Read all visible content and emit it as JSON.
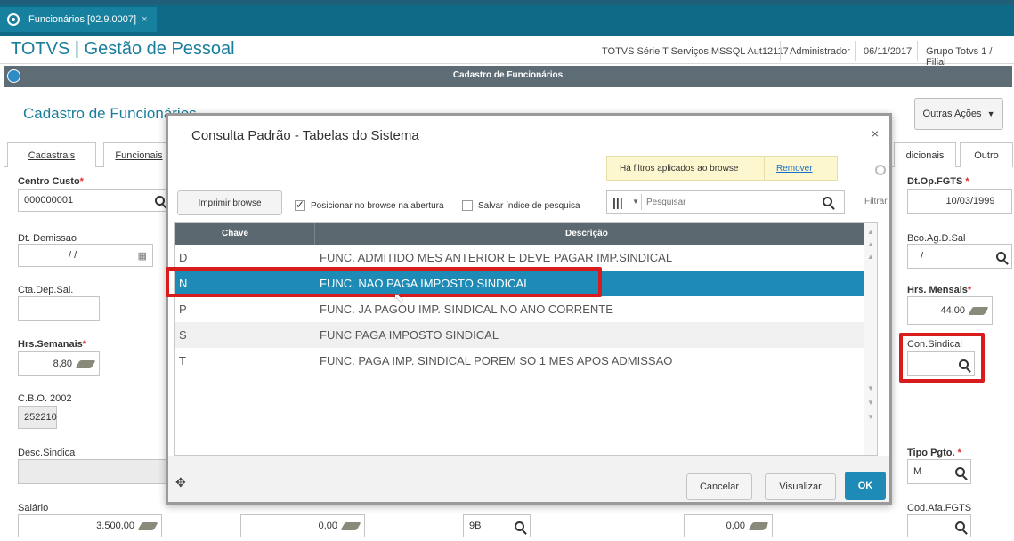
{
  "tab": {
    "label": "Funcionários [02.9.0007]",
    "close": "×"
  },
  "header": {
    "title": "TOTVS | Gestão de Pessoal",
    "server": "TOTVS Série T Serviços MSSQL Aut12117",
    "user": "Administrador",
    "date": "06/11/2017",
    "group": "Grupo Totvs 1 / Filial"
  },
  "formbar": {
    "title": "Cadastro de Funcionários"
  },
  "form": {
    "title": "Cadastro de Funcionários",
    "outras_acoes": "Outras Ações",
    "tabs": [
      "Cadastrais",
      "Funcionais",
      "dicionais",
      "Outro"
    ],
    "centro_custo": {
      "label": "Centro Custo",
      "value": "000000001"
    },
    "dt_demissao": {
      "label": "Dt. Demissao",
      "value": "/ /"
    },
    "cta_dep_sal": {
      "label": "Cta.Dep.Sal."
    },
    "hrs_semanais": {
      "label": "Hrs.Semanais",
      "value": "8,80"
    },
    "cbo": {
      "label": "C.B.O. 2002",
      "value": "252210"
    },
    "desc_sindica": {
      "label": "Desc.Sindica"
    },
    "salario": {
      "label": "Salário",
      "value": "3.500,00"
    },
    "dt_op_fgts": {
      "label": "Dt.Op.FGTS",
      "value": "10/03/1999"
    },
    "bco_ag": {
      "label": "Bco.Ag.D.Sal",
      "value": "/"
    },
    "hrs_mensais": {
      "label": "Hrs. Mensais",
      "value": "44,00"
    },
    "con_sindical": {
      "label": "Con.Sindical",
      "value": ""
    },
    "tipo_pgto": {
      "label": "Tipo Pgto.",
      "value": "M"
    },
    "cod_afa": {
      "label": "Cod.Afa.FGTS"
    },
    "bottom_vals": [
      "0,00",
      "9B",
      "0,00"
    ]
  },
  "modal": {
    "title": "Consulta Padrão - Tabelas do Sistema",
    "close": "×",
    "filter_msg": "Há filtros aplicados ao browse",
    "filter_remove": "Remover",
    "print_label": "Imprimir browse",
    "pos_label": "Posicionar no browse na abertura",
    "save_label": "Salvar índice de pesquisa",
    "search_placeholder": "Pesquisar",
    "filter_label": "Filtrar",
    "columns": [
      "Chave",
      "Descrição"
    ],
    "rows": [
      {
        "key": "D",
        "desc": "FUNC. ADMITIDO MES ANTERIOR E DEVE PAGAR IMP.SINDICAL"
      },
      {
        "key": "N",
        "desc": "FUNC. NAO PAGA IMPOSTO SINDICAL"
      },
      {
        "key": "P",
        "desc": "FUNC. JA PAGOU IMP. SINDICAL NO ANO CORRENTE"
      },
      {
        "key": "S",
        "desc": "FUNC PAGA IMPOSTO SINDICAL"
      },
      {
        "key": "T",
        "desc": "FUNC. PAGA IMP. SINDICAL POREM SO 1 MES APOS ADMISSAO"
      }
    ],
    "cancel": "Cancelar",
    "view": "Visualizar",
    "ok": "OK"
  }
}
